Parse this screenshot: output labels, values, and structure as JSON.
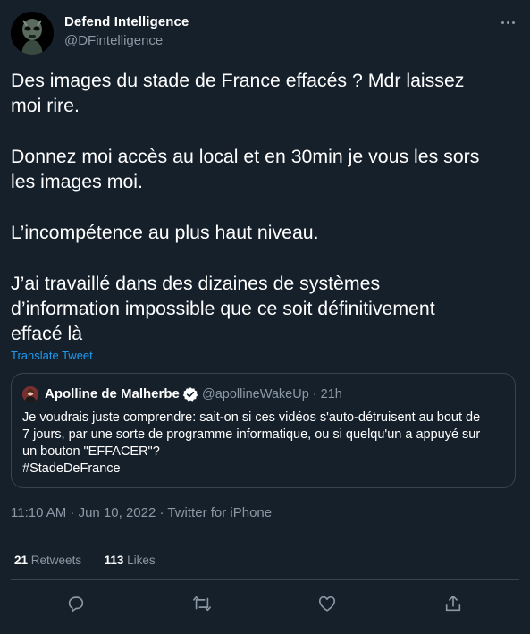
{
  "author": {
    "display_name": "Defend Intelligence",
    "handle": "@DFintelligence"
  },
  "tweet": {
    "paragraphs": [
      "Des images du stade de France effacés ? Mdr laissez\nmoi rire.",
      "Donnez moi accès au local et en 30min je vous les sors\nles images moi.",
      "L’incompétence au plus haut niveau.",
      "J’ai travaillé dans des dizaines de systèmes\nd’information impossible que ce soit définitivement\neffacé là"
    ],
    "translate_label": "Translate Tweet"
  },
  "quoted": {
    "display_name": "Apolline de Malherbe",
    "handle_time": "@apollineWakeUp · 21h",
    "text": "Je voudrais juste comprendre: sait-on si ces vidéos s'auto-détruisent au bout de\n7 jours, par une sorte de programme informatique, ou si quelqu'un a appuyé sur\nun bouton \"EFFACER\"?\n#StadeDeFrance"
  },
  "meta": {
    "timestamp": "11:10 AM · Jun 10, 2022 · Twitter for iPhone"
  },
  "stats": {
    "retweets_count": "21",
    "retweets_label": "Retweets",
    "likes_count": "113",
    "likes_label": "Likes"
  },
  "icons": {
    "more": "more-horizontal-icon",
    "reply": "reply-icon",
    "retweet": "retweet-icon",
    "like": "like-icon",
    "share": "share-icon",
    "verified": "verified-icon"
  },
  "colors": {
    "background": "#15202b",
    "text": "#ffffff",
    "muted": "#8b98a5",
    "accent": "#1d9bf0",
    "border": "#38444d"
  }
}
